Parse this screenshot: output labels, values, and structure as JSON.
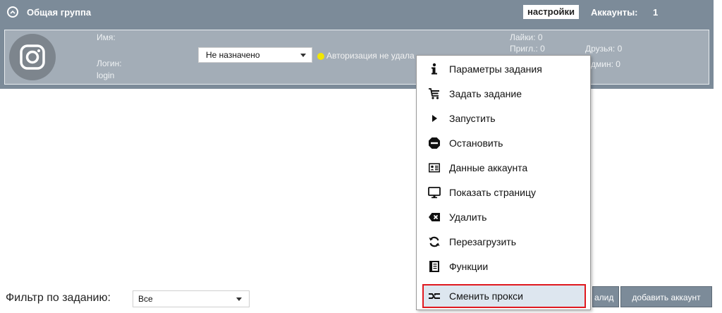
{
  "group": {
    "title": "Общая группа",
    "settings_label": "настройки",
    "accounts_label": "Аккаунты:",
    "accounts_count": "1"
  },
  "account": {
    "name_label": "Имя:",
    "login_label": "Логин:",
    "login_value": "login",
    "task_select_value": "Не назначено",
    "status_text": "Авторизация не удала",
    "likes_label": "Лайки: 0",
    "invites_label": "Пригл.: 0",
    "friends_label": "Друзья: 0",
    "admin_label": "Админ: 0"
  },
  "filter": {
    "label": "Фильтр по заданию:",
    "value": "Все"
  },
  "buttons": {
    "invalid_label": "алид",
    "add_account_label": "добавить аккаунт"
  },
  "context_menu": {
    "items": [
      {
        "label": "Параметры задания",
        "icon": "info-icon"
      },
      {
        "label": "Задать задание",
        "icon": "cart-icon"
      },
      {
        "label": "Запустить",
        "icon": "play-icon"
      },
      {
        "label": "Остановить",
        "icon": "stop-icon"
      },
      {
        "label": "Данные аккаунта",
        "icon": "id-card-icon"
      },
      {
        "label": "Показать страницу",
        "icon": "monitor-icon"
      },
      {
        "label": "Удалить",
        "icon": "delete-icon"
      },
      {
        "label": "Перезагрузить",
        "icon": "reload-icon"
      },
      {
        "label": "Функции",
        "icon": "book-icon"
      },
      {
        "label": "Сменить прокси",
        "icon": "swap-icon"
      }
    ],
    "selected_index": 9
  },
  "colors": {
    "bar": "#7c8b99",
    "card": "#a3adb7",
    "highlight_border": "#e0191f",
    "status_dot": "#f2e600"
  }
}
